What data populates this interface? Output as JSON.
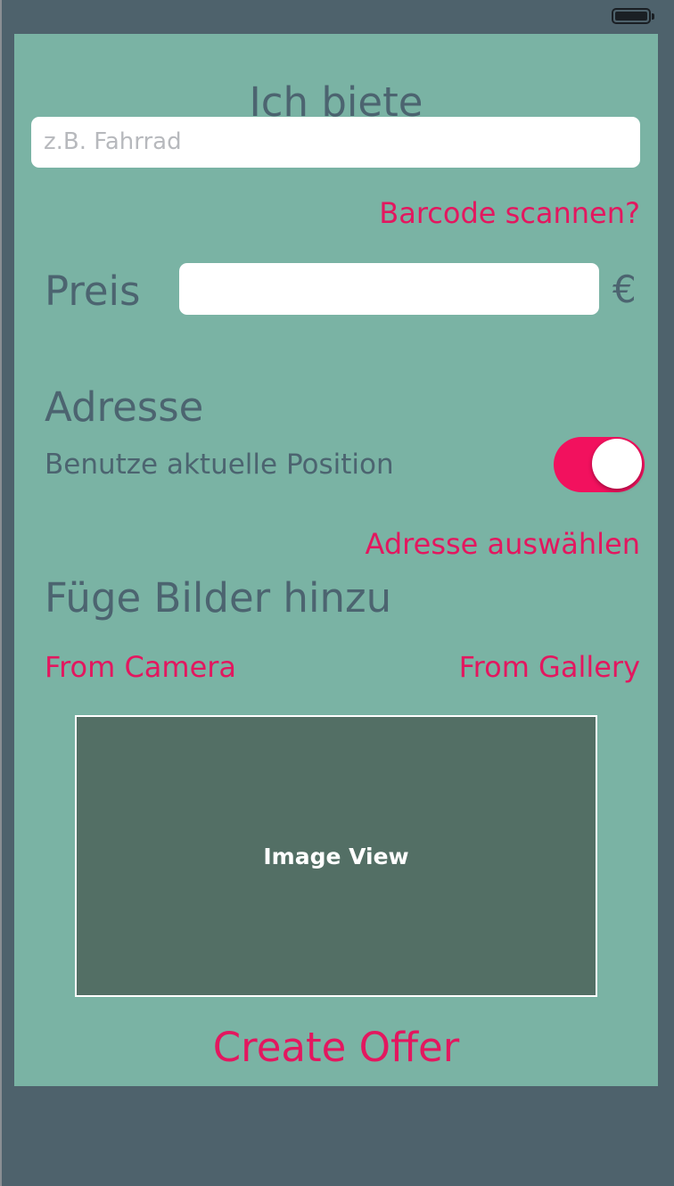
{
  "status_bar": {
    "battery_icon": "battery-full-icon"
  },
  "form": {
    "title": "Ich biete",
    "item_input": {
      "value": "",
      "placeholder": "z.B. Fahrrad"
    },
    "barcode_link": "Barcode scannen?",
    "price_label": "Preis",
    "price_input": {
      "value": ""
    },
    "currency": "€",
    "address_heading": "Adresse",
    "use_position_label": "Benutze aktuelle Position",
    "use_position_toggle": {
      "on": true
    },
    "select_address_link": "Adresse auswählen",
    "images_heading": "Füge Bilder hinzu",
    "from_camera": "From Camera",
    "from_gallery": "From Gallery",
    "image_view_label": "Image View",
    "create_button": "Create Offer"
  },
  "colors": {
    "accent": "#e3175f",
    "background": "#7ab3a4",
    "text": "#4c6470",
    "image_view": "#536f65"
  }
}
